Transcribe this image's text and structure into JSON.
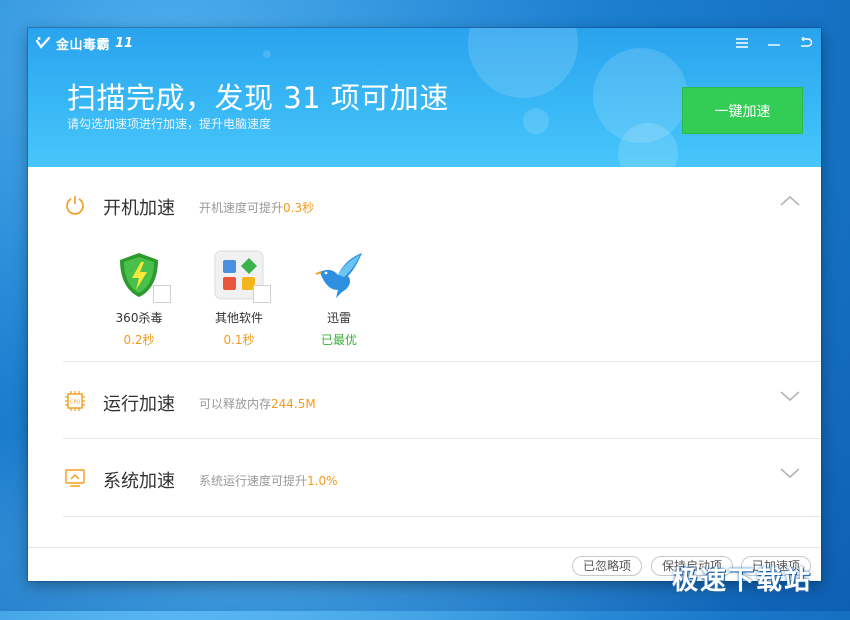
{
  "app": {
    "name": "金山毒霸",
    "version": "11"
  },
  "header": {
    "headline": "扫描完成，发现 31 项可加速",
    "subline": "请勾选加速项进行加速，提升电脑速度",
    "one_click_label": "一键加速"
  },
  "sections": [
    {
      "title": "开机加速",
      "desc": "开机速度可提升",
      "value": "0.3秒",
      "expanded": true,
      "items": [
        {
          "name": "360杀毒",
          "time": "0.2秒",
          "checked": false
        },
        {
          "name": "其他软件",
          "time": "0.1秒",
          "checked": false
        },
        {
          "name": "迅雷",
          "time": "已最优"
        }
      ]
    },
    {
      "title": "运行加速",
      "desc": "可以释放内存",
      "value": "244.5M",
      "expanded": false
    },
    {
      "title": "系统加速",
      "desc": "系统运行速度可提升",
      "value": "1.0%",
      "expanded": false
    }
  ],
  "footer": {
    "ignored_label": "已忽略项",
    "keep_startup_label": "保持启动项",
    "accelerated_label": "已加速项"
  },
  "watermark": "极速下载站",
  "colors": {
    "accent_green": "#33cc55",
    "header_blue": "#2aa3ee",
    "highlight_orange": "#f39b1c",
    "optimal_green": "#3cae3c"
  },
  "icons": [
    "logo-icon",
    "menu-icon",
    "minimize-icon",
    "back-icon",
    "power-icon",
    "cpu-icon",
    "system-icon",
    "chevron-up-icon",
    "chevron-down-icon"
  ]
}
